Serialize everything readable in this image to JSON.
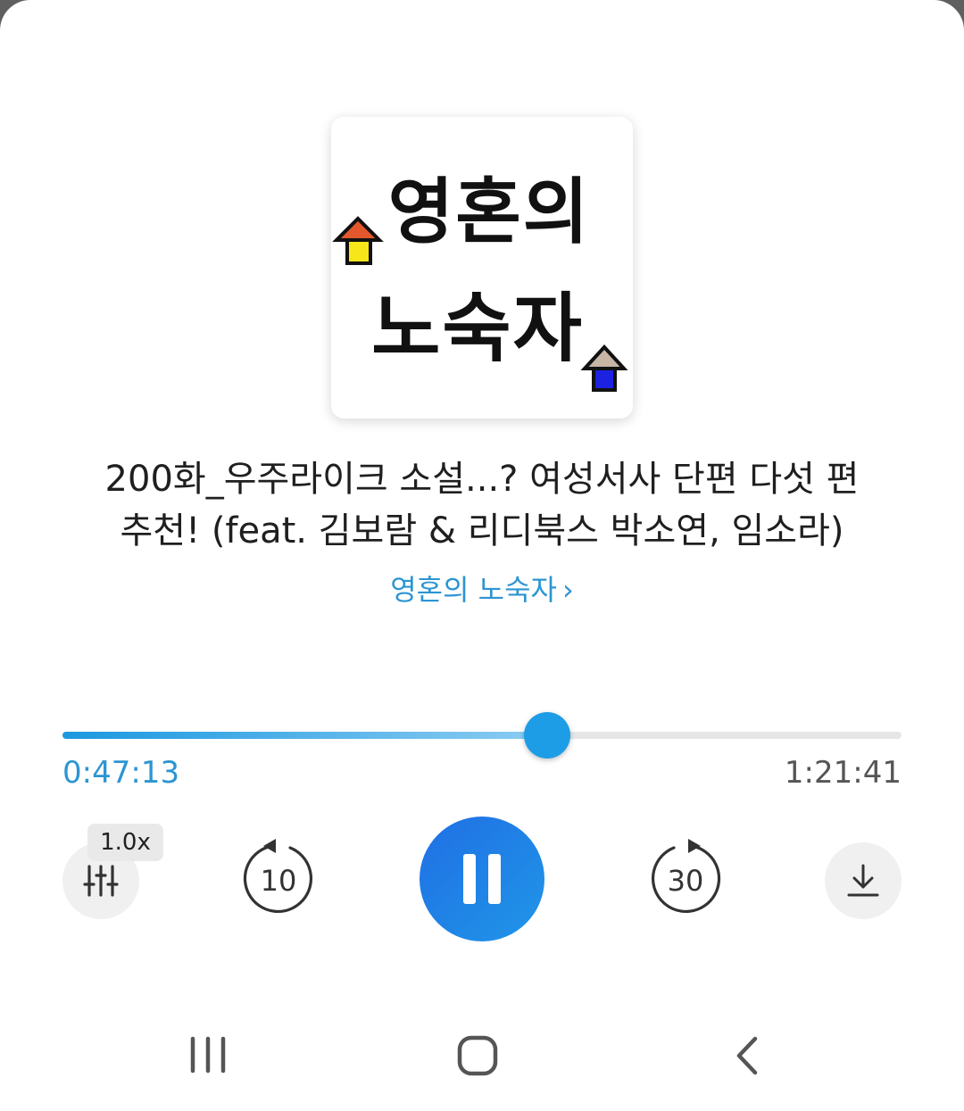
{
  "cover": {
    "line1": "영혼의",
    "line2": "노숙자"
  },
  "episode": {
    "title_line1": "200화_우주라이크 소설...? 여성서사 단편 다섯 편",
    "title_line2": "추천! (feat. 김보람 & 리디북스 박소연, 임소라)"
  },
  "channel": {
    "name": "영혼의 노숙자",
    "chevron": "›"
  },
  "player": {
    "elapsed": "0:47:13",
    "total": "1:21:41",
    "progress_fraction": 0.578,
    "speed": "1.0x",
    "skip_back_seconds": "10",
    "skip_forward_seconds": "30",
    "state": "playing"
  },
  "icons": {
    "equalizer": "equalizer-icon",
    "download": "download-icon",
    "pause": "pause-icon",
    "recents": "recents-icon",
    "home": "home-icon",
    "back": "back-icon"
  },
  "colors": {
    "accent": "#1d9de6",
    "link": "#2c95d2",
    "play_button": "#1f6fe4"
  }
}
